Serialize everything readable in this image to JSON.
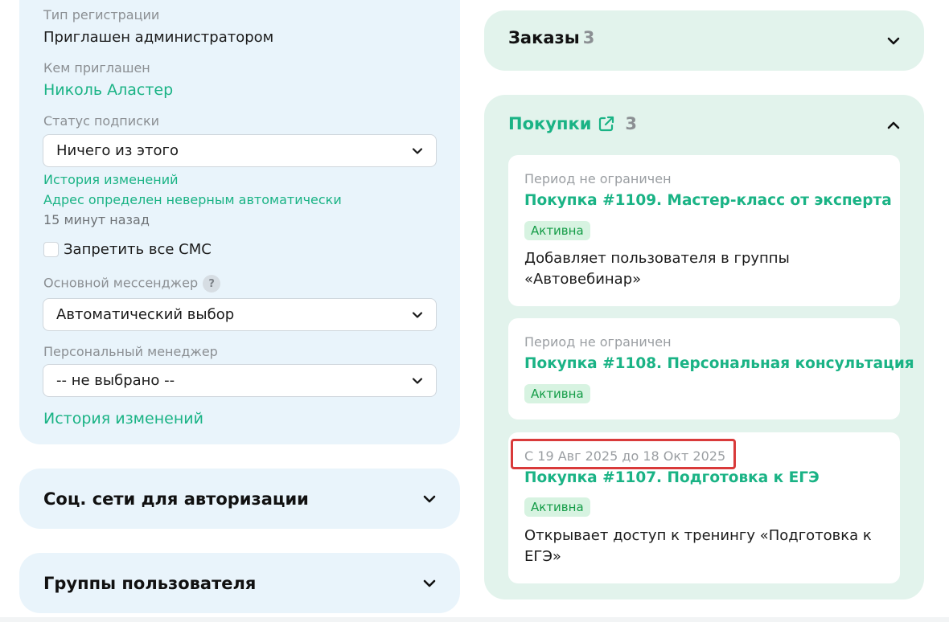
{
  "profile": {
    "registration_type_label": "Тип регистрации",
    "registration_type_value": "Приглашен администратором",
    "invited_by_label": "Кем приглашен",
    "invited_by_value": "Николь Аластер",
    "subscription_status_label": "Статус подписки",
    "subscription_status_value": "Ничего из этого",
    "history_link": "История изменений",
    "address_note": "Адрес определен неверным автоматически",
    "time_ago": "15 минут назад",
    "ban_sms_label": "Запретить все СМС",
    "ban_sms_checked": false,
    "messenger_label": "Основной мессенджер",
    "messenger_help": "?",
    "messenger_value": "Автоматический выбор",
    "manager_label": "Персональный менеджер",
    "manager_value": "-- не выбрано --",
    "history_link_2": "История изменений"
  },
  "social_section": {
    "title": "Соц. сети для авторизации"
  },
  "groups_section": {
    "title": "Группы пользователя"
  },
  "orders": {
    "title": "Заказы",
    "count": "3"
  },
  "purchases": {
    "title": "Покупки",
    "count": "3",
    "items": [
      {
        "period": "Период не ограничен",
        "title": "Покупка #1109. Мастер-класс от эксперта",
        "status": "Активна",
        "description": "Добавляет пользователя в группы «Автовебинар»"
      },
      {
        "period": "Период не ограничен",
        "title": "Покупка #1108. Персональная консультация",
        "status": "Активна",
        "description": ""
      },
      {
        "period": "С 19 Авг 2025 до 18 Окт 2025",
        "title": "Покупка #1107. Подготовка к ЕГЭ",
        "status": "Активна",
        "description": "Открывает доступ к тренингу «Подготовка к ЕГЭ»"
      }
    ]
  },
  "colors": {
    "accent_green": "#1ab385",
    "badge_bg": "#d7f3e1",
    "badge_text": "#149c47",
    "left_panel_bg": "#e9f4fb",
    "right_panel_bg": "#e2f3ec",
    "highlight_red": "#d93a3a"
  }
}
